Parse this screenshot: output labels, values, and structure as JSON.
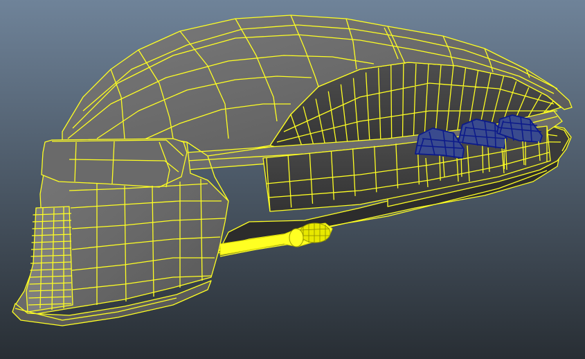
{
  "viewport": {
    "background_top": "#6f8399",
    "background_bottom": "#282e34"
  },
  "model": {
    "wire_color": "#ffff22",
    "shell_face": "#6b6b6b",
    "shell_face_light": "#7a7a7a",
    "shell_face_dark": "#4a4a4a",
    "inner_face": "#474747",
    "inner_face_dark": "#353535",
    "selected_wire": "#0c1a8a",
    "selected_face": "#3a4b8e"
  }
}
